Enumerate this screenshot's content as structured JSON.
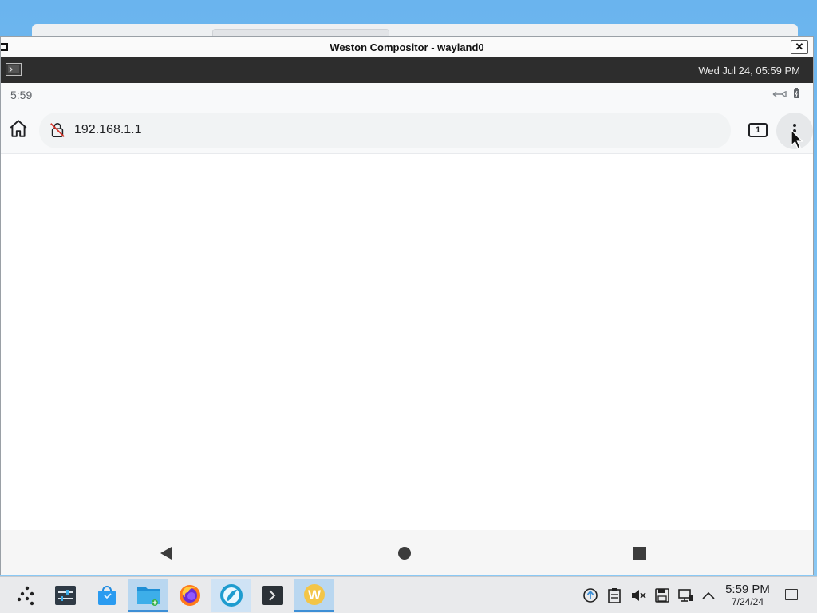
{
  "window": {
    "title": "Weston Compositor - wayland0",
    "close_glyph": "✕"
  },
  "panel": {
    "clock": "Wed Jul 24, 05:59 PM"
  },
  "android": {
    "status_time": "5:59",
    "url": "192.168.1.1",
    "tab_count": "1"
  },
  "taskbar": {
    "apps": [
      "app-launcher-icon",
      "system-settings-icon",
      "discover-store-icon",
      "file-manager-icon",
      "firefox-icon",
      "browser-icon",
      "terminal-icon",
      "waydroid-icon"
    ],
    "time": "5:59 PM",
    "date": "7/24/24"
  },
  "colors": {
    "desktop_bg": "#6ab4ee",
    "panel_bg": "#2d2d2d",
    "toolbar_bg": "#f8f9fa",
    "urlbar_bg": "#f1f3f4",
    "taskbar_bg": "#e9eaec",
    "active_task": "#b9d7f0"
  }
}
